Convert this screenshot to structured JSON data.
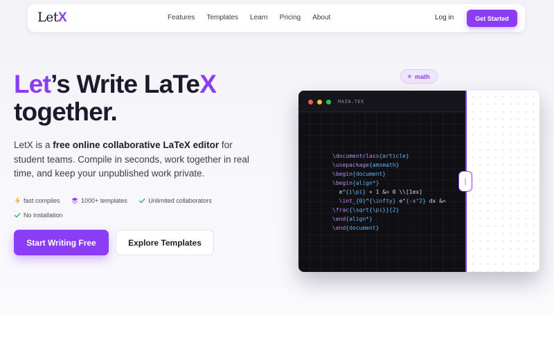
{
  "nav": {
    "logo_text": "Let",
    "logo_accent": "X",
    "links": [
      "Features",
      "Templates",
      "Learn",
      "Pricing",
      "About"
    ],
    "login": "Log in",
    "cta": "Get Started"
  },
  "hero": {
    "title_accent": "Let",
    "title_rest_1": "’s Write LaTe",
    "title_accent_2": "X",
    "title_line_2": "together.",
    "desc_1": "LetX is a ",
    "desc_bold": "free online collaborative LaTeX editor",
    "desc_2": " for student teams. Compile in seconds, work together in real time, and keep your unpublished work private.",
    "features": [
      {
        "icon": "bolt-icon",
        "label": "fast compiles"
      },
      {
        "icon": "layers-icon",
        "label": "1000+ templates"
      },
      {
        "icon": "check-icon",
        "label": "Unlimited collaborators"
      },
      {
        "icon": "check-icon",
        "label": "No installation"
      }
    ],
    "primary_button": "Start Writing Free",
    "secondary_button": "Explore Templates"
  },
  "editor": {
    "badge": "math",
    "file_name": "MAIN.TEX",
    "code_lines": [
      [
        [
          "c-cmd",
          "\\documentclass"
        ],
        [
          "c-arg",
          "{article}"
        ]
      ],
      [
        [
          "c-cmd",
          "\\usepackage"
        ],
        [
          "c-arg",
          "{amsmath}"
        ]
      ],
      [
        [
          "c-cmd",
          "\\begin"
        ],
        [
          "c-arg",
          "{document}"
        ]
      ],
      [
        [
          "c-cmd",
          "\\begin"
        ],
        [
          "c-arg",
          "{align*}"
        ]
      ],
      [
        [
          "c-plain",
          "  e^"
        ],
        [
          "c-arg",
          "{i\\pi}"
        ],
        [
          "c-plain",
          " + 1 &= 0 \\\\[1ex]"
        ]
      ],
      [
        [
          "c-plain",
          "  "
        ],
        [
          "c-cmd",
          "\\int"
        ],
        [
          "c-plain",
          "_"
        ],
        [
          "c-arg",
          "{0}"
        ],
        [
          "c-plain",
          "^"
        ],
        [
          "c-arg",
          "{\\infty}"
        ],
        [
          "c-plain",
          " e^"
        ],
        [
          "c-arg",
          "{-x^2}"
        ],
        [
          "c-plain",
          " dx &="
        ]
      ],
      [
        [
          "c-cmd",
          "\\frac"
        ],
        [
          "c-arg",
          "{\\sqrt{\\pi}}"
        ],
        [
          "c-arg",
          "{2}"
        ]
      ],
      [
        [
          "c-cmd",
          "\\end"
        ],
        [
          "c-arg",
          "{align*}"
        ]
      ],
      [
        [
          "c-cmd",
          "\\end"
        ],
        [
          "c-arg",
          "{document}"
        ]
      ]
    ]
  },
  "colors": {
    "brand": "#8b3df5",
    "dark": "#1c1c2b",
    "editor_bg": "#101014"
  }
}
